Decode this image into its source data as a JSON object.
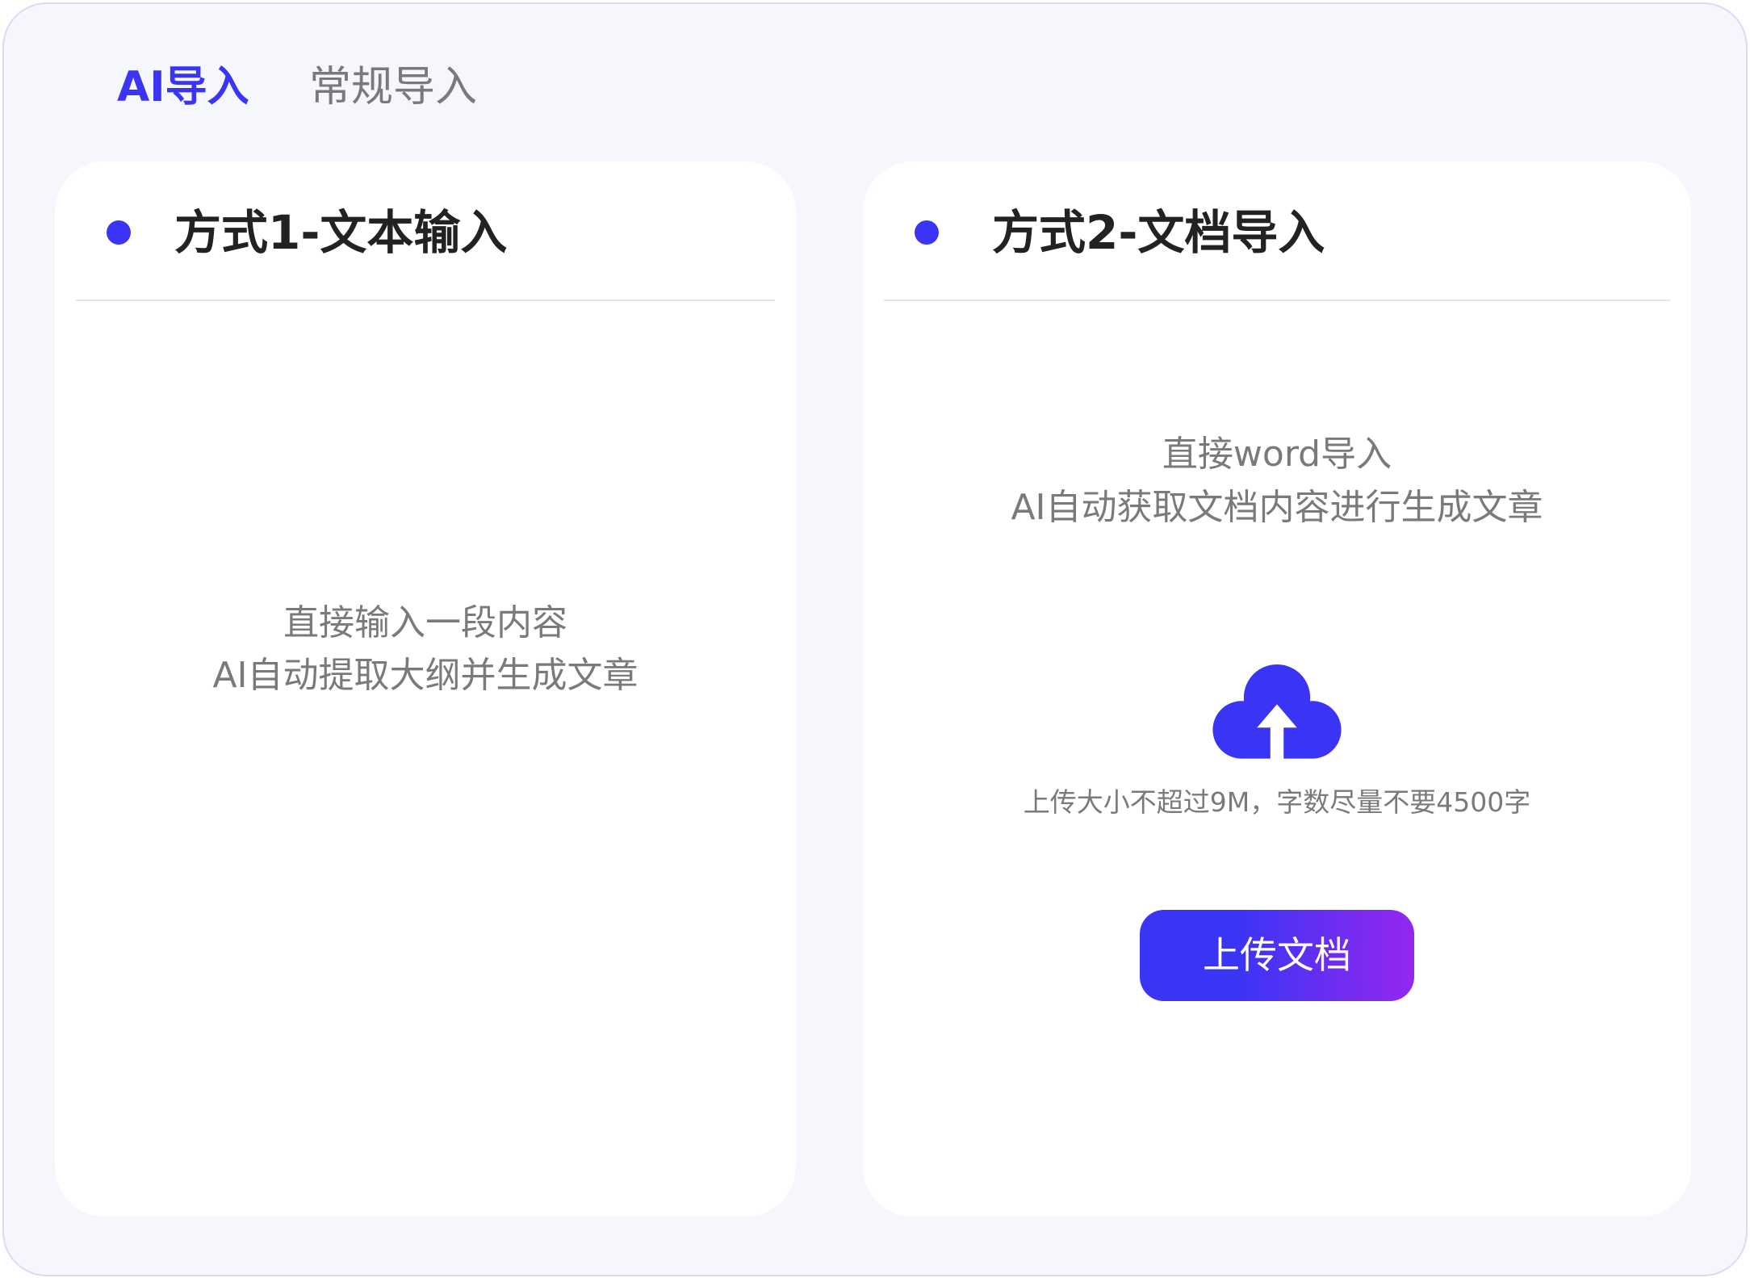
{
  "tabs": [
    {
      "label": "AI导入",
      "active": true
    },
    {
      "label": "常规导入",
      "active": false
    }
  ],
  "cards": {
    "text_input": {
      "title": "方式1-文本输入",
      "lines": [
        "直接输入一段内容",
        "AI自动提取大纲并生成文章"
      ]
    },
    "doc_import": {
      "title": "方式2-文档导入",
      "lines": [
        "直接word导入",
        "AI自动获取文档内容进行生成文章"
      ],
      "upload_hint": "上传大小不超过9M，字数尽量不要4500字",
      "upload_button": "上传文档",
      "icon": "upload-cloud-icon"
    }
  },
  "colors": {
    "accent": "#3a35f5",
    "accent_end": "#9527ee",
    "muted_text": "#7a7a7a",
    "title_text": "#222222",
    "panel_background": "#f5f7fd"
  }
}
